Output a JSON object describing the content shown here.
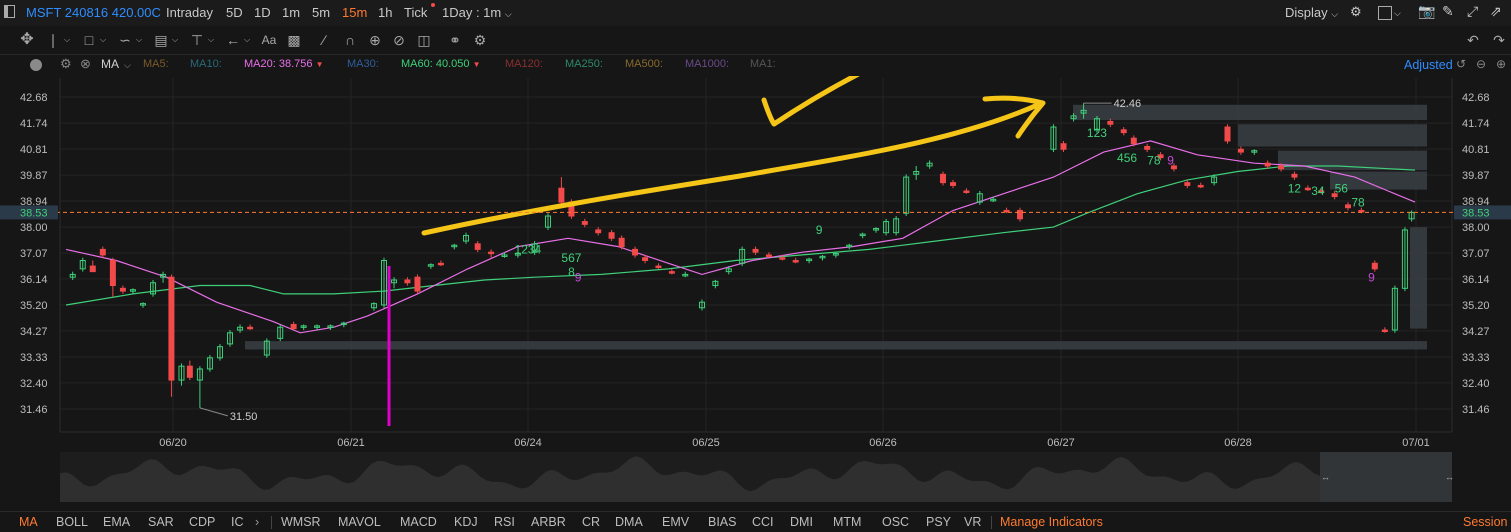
{
  "topbar": {
    "symbol": "MSFT 240816 420.00C",
    "tabs": [
      {
        "label": "Intraday",
        "active": false
      },
      {
        "label": "5D",
        "active": false
      },
      {
        "label": "1D",
        "active": false
      },
      {
        "label": "1m",
        "active": false
      },
      {
        "label": "5m",
        "active": false
      },
      {
        "label": "15m",
        "active": true
      },
      {
        "label": "1h",
        "active": false
      },
      {
        "label": "Tick",
        "active": false
      }
    ],
    "interval_select": "1Day : 1m",
    "display_label": "Display"
  },
  "indicator_bar": {
    "main": "MA",
    "items": [
      {
        "label": "MA5:",
        "value": "",
        "color": "#7a5a2a"
      },
      {
        "label": "MA10:",
        "value": "",
        "color": "#2a5a6a"
      },
      {
        "label": "MA20:",
        "value": "38.756",
        "color": "#e86fe8"
      },
      {
        "label": "MA30:",
        "value": "",
        "color": "#2d4f7a"
      },
      {
        "label": "MA60:",
        "value": "40.050",
        "color": "#3fd07a"
      },
      {
        "label": "MA120:",
        "value": "",
        "color": "#7a2d2d"
      },
      {
        "label": "MA250:",
        "value": "",
        "color": "#2d7a5a"
      },
      {
        "label": "MA500:",
        "value": "",
        "color": "#7a5a2d"
      },
      {
        "label": "MA1000:",
        "value": "",
        "color": "#5a3d7a"
      },
      {
        "label": "MA1:",
        "value": "",
        "color": "#555555"
      }
    ],
    "adjusted_label": "Adjusted"
  },
  "colors": {
    "up": "#3fd07a",
    "down": "#f24a4a",
    "ma20": "#e86fe8",
    "ma60": "#3fd07a",
    "last_price_bg": "#2b3a48",
    "annotation": "#f5c518"
  },
  "chart_data": {
    "type": "candlestick",
    "y_ticks": [
      "42.68",
      "41.74",
      "40.81",
      "39.87",
      "38.94",
      "38.00",
      "37.07",
      "36.14",
      "35.20",
      "34.27",
      "33.33",
      "32.40",
      "31.46"
    ],
    "x_ticks": [
      "06/20",
      "06/21",
      "06/24",
      "06/25",
      "06/26",
      "06/27",
      "06/28",
      "07/01"
    ],
    "last_price": "38.53",
    "high_label": "42.46",
    "low_label": "31.50",
    "ylim": [
      30.8,
      43.1
    ],
    "candles": [
      {
        "t": 0.2,
        "o": 36.2,
        "h": 36.4,
        "l": 36.1,
        "c": 36.3
      },
      {
        "t": 0.5,
        "o": 36.5,
        "h": 36.9,
        "l": 36.4,
        "c": 36.8
      },
      {
        "t": 0.8,
        "o": 36.6,
        "h": 36.8,
        "l": 36.5,
        "c": 36.4
      },
      {
        "t": 1.1,
        "o": 37.2,
        "h": 37.3,
        "l": 36.9,
        "c": 37.0
      },
      {
        "t": 1.4,
        "o": 36.8,
        "h": 36.9,
        "l": 35.5,
        "c": 35.9
      },
      {
        "t": 1.7,
        "o": 35.8,
        "h": 35.9,
        "l": 35.6,
        "c": 35.7
      },
      {
        "t": 2.0,
        "o": 35.7,
        "h": 35.8,
        "l": 35.6,
        "c": 35.75
      },
      {
        "t": 2.3,
        "o": 35.2,
        "h": 35.3,
        "l": 35.1,
        "c": 35.25
      },
      {
        "t": 2.6,
        "o": 35.6,
        "h": 36.1,
        "l": 35.5,
        "c": 36.0
      },
      {
        "t": 2.9,
        "o": 36.2,
        "h": 36.4,
        "l": 36.0,
        "c": 36.3
      },
      {
        "t": 3.15,
        "o": 36.2,
        "h": 36.3,
        "l": 31.9,
        "c": 32.5
      },
      {
        "t": 3.45,
        "o": 32.5,
        "h": 33.1,
        "l": 32.3,
        "c": 33.0
      },
      {
        "t": 3.7,
        "o": 33.0,
        "h": 33.2,
        "l": 32.5,
        "c": 32.6
      },
      {
        "t": 4.0,
        "o": 32.5,
        "h": 33.0,
        "l": 31.5,
        "c": 32.9
      },
      {
        "t": 4.3,
        "o": 32.9,
        "h": 33.4,
        "l": 32.8,
        "c": 33.3
      },
      {
        "t": 4.6,
        "o": 33.3,
        "h": 33.8,
        "l": 33.2,
        "c": 33.7
      },
      {
        "t": 4.9,
        "o": 33.8,
        "h": 34.3,
        "l": 33.7,
        "c": 34.2
      },
      {
        "t": 5.2,
        "o": 34.3,
        "h": 34.5,
        "l": 34.2,
        "c": 34.4
      },
      {
        "t": 5.5,
        "o": 34.4,
        "h": 34.5,
        "l": 34.3,
        "c": 34.35
      },
      {
        "t": 6.0,
        "o": 33.4,
        "h": 34.0,
        "l": 33.3,
        "c": 33.9
      },
      {
        "t": 6.4,
        "o": 34.0,
        "h": 34.5,
        "l": 33.9,
        "c": 34.4
      },
      {
        "t": 6.8,
        "o": 34.5,
        "h": 34.6,
        "l": 34.3,
        "c": 34.35
      },
      {
        "t": 7.1,
        "o": 34.4,
        "h": 34.5,
        "l": 34.3,
        "c": 34.45
      },
      {
        "t": 7.5,
        "o": 34.4,
        "h": 34.5,
        "l": 34.3,
        "c": 34.45
      },
      {
        "t": 7.9,
        "o": 34.4,
        "h": 34.5,
        "l": 34.3,
        "c": 34.45
      },
      {
        "t": 8.3,
        "o": 34.5,
        "h": 34.6,
        "l": 34.4,
        "c": 34.55
      },
      {
        "t": 9.2,
        "o": 35.1,
        "h": 35.3,
        "l": 35.0,
        "c": 35.25
      },
      {
        "t": 9.5,
        "o": 35.2,
        "h": 36.9,
        "l": 35.1,
        "c": 36.8
      },
      {
        "t": 9.8,
        "o": 36.0,
        "h": 36.2,
        "l": 35.8,
        "c": 36.1
      },
      {
        "t": 10.2,
        "o": 36.1,
        "h": 36.2,
        "l": 35.9,
        "c": 36.0
      },
      {
        "t": 10.5,
        "o": 36.2,
        "h": 36.3,
        "l": 35.6,
        "c": 35.7
      },
      {
        "t": 10.9,
        "o": 36.6,
        "h": 36.7,
        "l": 36.5,
        "c": 36.65
      },
      {
        "t": 11.2,
        "o": 36.7,
        "h": 36.8,
        "l": 36.6,
        "c": 36.65
      },
      {
        "t": 11.6,
        "o": 37.3,
        "h": 37.4,
        "l": 37.2,
        "c": 37.35
      },
      {
        "t": 11.95,
        "o": 37.5,
        "h": 37.8,
        "l": 37.4,
        "c": 37.7
      },
      {
        "t": 12.3,
        "o": 37.4,
        "h": 37.5,
        "l": 37.1,
        "c": 37.2
      },
      {
        "t": 12.7,
        "o": 37.1,
        "h": 37.2,
        "l": 36.9,
        "c": 37.05
      },
      {
        "t": 13.1,
        "o": 37.0,
        "h": 37.1,
        "l": 36.9,
        "c": 37.0
      },
      {
        "t": 13.5,
        "o": 37.0,
        "h": 37.1,
        "l": 36.9,
        "c": 37.05
      },
      {
        "t": 14.0,
        "o": 37.1,
        "h": 37.5,
        "l": 37.0,
        "c": 37.4
      },
      {
        "t": 14.4,
        "o": 38.0,
        "h": 38.5,
        "l": 37.9,
        "c": 38.4
      },
      {
        "t": 14.8,
        "o": 39.4,
        "h": 39.8,
        "l": 38.8,
        "c": 38.9
      },
      {
        "t": 15.1,
        "o": 38.9,
        "h": 39.0,
        "l": 38.3,
        "c": 38.4
      },
      {
        "t": 15.5,
        "o": 38.2,
        "h": 38.3,
        "l": 38.0,
        "c": 38.1
      },
      {
        "t": 15.9,
        "o": 37.9,
        "h": 38.0,
        "l": 37.7,
        "c": 37.8
      },
      {
        "t": 16.3,
        "o": 37.8,
        "h": 37.9,
        "l": 37.5,
        "c": 37.6
      },
      {
        "t": 16.6,
        "o": 37.6,
        "h": 37.7,
        "l": 37.2,
        "c": 37.3
      },
      {
        "t": 17.0,
        "o": 37.2,
        "h": 37.3,
        "l": 36.9,
        "c": 37.0
      },
      {
        "t": 17.3,
        "o": 36.9,
        "h": 37.0,
        "l": 36.7,
        "c": 36.8
      },
      {
        "t": 17.7,
        "o": 36.6,
        "h": 36.7,
        "l": 36.5,
        "c": 36.55
      },
      {
        "t": 18.1,
        "o": 36.4,
        "h": 36.5,
        "l": 36.3,
        "c": 36.35
      },
      {
        "t": 18.5,
        "o": 36.3,
        "h": 36.4,
        "l": 36.2,
        "c": 36.3
      },
      {
        "t": 19.0,
        "o": 35.1,
        "h": 35.4,
        "l": 35.0,
        "c": 35.3
      },
      {
        "t": 19.4,
        "o": 35.9,
        "h": 36.1,
        "l": 35.8,
        "c": 36.05
      },
      {
        "t": 19.8,
        "o": 36.4,
        "h": 36.6,
        "l": 36.3,
        "c": 36.5
      },
      {
        "t": 20.2,
        "o": 36.7,
        "h": 37.3,
        "l": 36.6,
        "c": 37.2
      },
      {
        "t": 20.6,
        "o": 37.2,
        "h": 37.3,
        "l": 37.0,
        "c": 37.1
      },
      {
        "t": 21.0,
        "o": 37.0,
        "h": 37.1,
        "l": 36.9,
        "c": 36.95
      },
      {
        "t": 21.4,
        "o": 36.9,
        "h": 37.0,
        "l": 36.8,
        "c": 36.85
      },
      {
        "t": 21.8,
        "o": 36.8,
        "h": 36.9,
        "l": 36.7,
        "c": 36.75
      },
      {
        "t": 22.2,
        "o": 36.8,
        "h": 36.9,
        "l": 36.7,
        "c": 36.85
      },
      {
        "t": 22.6,
        "o": 36.9,
        "h": 37.0,
        "l": 36.8,
        "c": 36.95
      },
      {
        "t": 23.0,
        "o": 37.0,
        "h": 37.1,
        "l": 36.9,
        "c": 37.05
      },
      {
        "t": 23.4,
        "o": 37.3,
        "h": 37.4,
        "l": 37.2,
        "c": 37.35
      },
      {
        "t": 23.8,
        "o": 37.7,
        "h": 37.8,
        "l": 37.6,
        "c": 37.75
      },
      {
        "t": 24.2,
        "o": 37.9,
        "h": 38.0,
        "l": 37.8,
        "c": 37.95
      },
      {
        "t": 24.5,
        "o": 37.8,
        "h": 38.3,
        "l": 37.7,
        "c": 38.2
      },
      {
        "t": 24.8,
        "o": 37.8,
        "h": 38.4,
        "l": 37.7,
        "c": 38.3
      },
      {
        "t": 25.1,
        "o": 38.5,
        "h": 39.9,
        "l": 38.4,
        "c": 39.8
      },
      {
        "t": 25.4,
        "o": 39.9,
        "h": 40.2,
        "l": 39.7,
        "c": 40.0
      },
      {
        "t": 25.8,
        "o": 40.2,
        "h": 40.4,
        "l": 40.1,
        "c": 40.3
      },
      {
        "t": 26.2,
        "o": 39.9,
        "h": 40.0,
        "l": 39.5,
        "c": 39.6
      },
      {
        "t": 26.5,
        "o": 39.6,
        "h": 39.7,
        "l": 39.4,
        "c": 39.5
      },
      {
        "t": 26.9,
        "o": 39.3,
        "h": 39.4,
        "l": 39.2,
        "c": 39.25
      },
      {
        "t": 27.3,
        "o": 38.9,
        "h": 39.3,
        "l": 38.8,
        "c": 39.2
      },
      {
        "t": 27.7,
        "o": 39.0,
        "h": 39.1,
        "l": 38.9,
        "c": 39.0
      },
      {
        "t": 28.1,
        "o": 38.6,
        "h": 38.7,
        "l": 38.5,
        "c": 38.55
      },
      {
        "t": 28.5,
        "o": 38.6,
        "h": 38.7,
        "l": 38.2,
        "c": 38.3
      },
      {
        "t": 29.5,
        "o": 40.8,
        "h": 41.7,
        "l": 40.7,
        "c": 41.6
      },
      {
        "t": 29.8,
        "o": 41.0,
        "h": 41.1,
        "l": 40.7,
        "c": 40.8
      },
      {
        "t": 30.1,
        "o": 41.9,
        "h": 42.1,
        "l": 41.8,
        "c": 42.0
      },
      {
        "t": 30.4,
        "o": 42.1,
        "h": 42.46,
        "l": 41.9,
        "c": 42.2
      },
      {
        "t": 30.8,
        "o": 41.5,
        "h": 42.0,
        "l": 41.4,
        "c": 41.9
      },
      {
        "t": 31.2,
        "o": 41.8,
        "h": 41.9,
        "l": 41.6,
        "c": 41.7
      },
      {
        "t": 31.6,
        "o": 41.5,
        "h": 41.6,
        "l": 41.3,
        "c": 41.4
      },
      {
        "t": 31.9,
        "o": 41.2,
        "h": 41.3,
        "l": 40.9,
        "c": 41.0
      },
      {
        "t": 32.3,
        "o": 40.9,
        "h": 41.0,
        "l": 40.7,
        "c": 40.8
      },
      {
        "t": 32.7,
        "o": 40.6,
        "h": 40.7,
        "l": 40.4,
        "c": 40.5
      },
      {
        "t": 33.1,
        "o": 40.2,
        "h": 40.3,
        "l": 40.0,
        "c": 40.1
      },
      {
        "t": 33.5,
        "o": 39.6,
        "h": 39.7,
        "l": 39.4,
        "c": 39.5
      },
      {
        "t": 33.9,
        "o": 39.5,
        "h": 39.6,
        "l": 39.4,
        "c": 39.45
      },
      {
        "t": 34.3,
        "o": 39.6,
        "h": 39.9,
        "l": 39.5,
        "c": 39.8
      },
      {
        "t": 34.7,
        "o": 41.6,
        "h": 41.7,
        "l": 41.0,
        "c": 41.1
      },
      {
        "t": 35.1,
        "o": 40.8,
        "h": 40.9,
        "l": 40.6,
        "c": 40.7
      },
      {
        "t": 35.5,
        "o": 40.7,
        "h": 40.8,
        "l": 40.6,
        "c": 40.75
      },
      {
        "t": 35.9,
        "o": 40.3,
        "h": 40.4,
        "l": 40.1,
        "c": 40.2
      },
      {
        "t": 36.3,
        "o": 40.2,
        "h": 40.3,
        "l": 40.0,
        "c": 40.1
      },
      {
        "t": 36.7,
        "o": 39.9,
        "h": 40.0,
        "l": 39.7,
        "c": 39.8
      },
      {
        "t": 37.1,
        "o": 39.4,
        "h": 39.5,
        "l": 39.3,
        "c": 39.35
      },
      {
        "t": 37.5,
        "o": 39.3,
        "h": 39.4,
        "l": 39.2,
        "c": 39.25
      },
      {
        "t": 37.9,
        "o": 39.2,
        "h": 39.3,
        "l": 39.0,
        "c": 39.1
      },
      {
        "t": 38.3,
        "o": 38.8,
        "h": 38.9,
        "l": 38.6,
        "c": 38.7
      },
      {
        "t": 38.7,
        "o": 38.6,
        "h": 38.7,
        "l": 38.5,
        "c": 38.55
      },
      {
        "t": 39.1,
        "o": 36.7,
        "h": 36.8,
        "l": 36.4,
        "c": 36.5
      },
      {
        "t": 39.4,
        "o": 34.3,
        "h": 34.4,
        "l": 34.2,
        "c": 34.25
      },
      {
        "t": 39.7,
        "o": 34.3,
        "h": 35.9,
        "l": 34.2,
        "c": 35.8
      },
      {
        "t": 40.0,
        "o": 35.8,
        "h": 38.0,
        "l": 35.7,
        "c": 37.9
      },
      {
        "t": 40.2,
        "o": 38.3,
        "h": 38.6,
        "l": 38.2,
        "c": 38.53
      }
    ],
    "ma20": [
      [
        0,
        37.2
      ],
      [
        1.5,
        36.8
      ],
      [
        3,
        36.2
      ],
      [
        4.5,
        35.3
      ],
      [
        6.2,
        34.6
      ],
      [
        7,
        34.2
      ],
      [
        8,
        34.4
      ],
      [
        9,
        34.8
      ],
      [
        10.5,
        35.6
      ],
      [
        12,
        36.5
      ],
      [
        13.5,
        37.3
      ],
      [
        15,
        37.6
      ],
      [
        16.5,
        37.3
      ],
      [
        18,
        36.7
      ],
      [
        19,
        36.3
      ],
      [
        20.5,
        36.8
      ],
      [
        22,
        37.1
      ],
      [
        23.5,
        37.3
      ],
      [
        25,
        37.6
      ],
      [
        26.5,
        38.6
      ],
      [
        28,
        39.2
      ],
      [
        29.5,
        39.8
      ],
      [
        31,
        40.7
      ],
      [
        32.4,
        41.1
      ],
      [
        33.8,
        40.6
      ],
      [
        35.5,
        40.3
      ],
      [
        37,
        40.2
      ],
      [
        38.5,
        39.8
      ],
      [
        39.5,
        39.3
      ],
      [
        40.3,
        38.9
      ]
    ],
    "ma60": [
      [
        0,
        35.2
      ],
      [
        2,
        35.6
      ],
      [
        4,
        35.9
      ],
      [
        5.5,
        35.9
      ],
      [
        6.5,
        35.6
      ],
      [
        8,
        35.6
      ],
      [
        9.5,
        35.7
      ],
      [
        11,
        35.9
      ],
      [
        12.5,
        36.1
      ],
      [
        14,
        36.2
      ],
      [
        16,
        36.3
      ],
      [
        18,
        36.5
      ],
      [
        20,
        36.8
      ],
      [
        22,
        37.0
      ],
      [
        24,
        37.2
      ],
      [
        26,
        37.5
      ],
      [
        28,
        37.8
      ],
      [
        29.5,
        38.0
      ],
      [
        30.5,
        38.5
      ],
      [
        32,
        39.2
      ],
      [
        33.5,
        39.7
      ],
      [
        35,
        40.0
      ],
      [
        36.5,
        40.2
      ],
      [
        38,
        40.2
      ],
      [
        39.5,
        40.1
      ],
      [
        40.3,
        40.05
      ]
    ],
    "labels": [
      {
        "t": 22.4,
        "v": 37.75,
        "text": "9",
        "color": "#3fd07a"
      },
      {
        "t": 13.4,
        "v": 37.05,
        "text": "1234",
        "color": "#3fd07a"
      },
      {
        "t": 14.8,
        "v": 36.75,
        "text": "567",
        "color": "#3fd07a"
      },
      {
        "t": 15.0,
        "v": 36.25,
        "text": "8",
        "color": "#3fd07a"
      },
      {
        "t": 15.2,
        "v": 36.05,
        "text": "9",
        "color": "#c84adc"
      },
      {
        "t": 30.5,
        "v": 41.25,
        "text": "123",
        "color": "#3fd07a"
      },
      {
        "t": 31.4,
        "v": 40.35,
        "text": "456",
        "color": "#3fd07a"
      },
      {
        "t": 32.3,
        "v": 40.25,
        "text": "78",
        "color": "#3fd07a"
      },
      {
        "t": 32.9,
        "v": 40.25,
        "text": "9",
        "color": "#c84adc"
      },
      {
        "t": 36.5,
        "v": 39.25,
        "text": "12",
        "color": "#3fd07a"
      },
      {
        "t": 37.2,
        "v": 39.15,
        "text": "34",
        "color": "#3fd07a"
      },
      {
        "t": 37.9,
        "v": 39.25,
        "text": "56",
        "color": "#3fd07a"
      },
      {
        "t": 38.4,
        "v": 38.75,
        "text": "78",
        "color": "#3fd07a"
      },
      {
        "t": 38.9,
        "v": 36.05,
        "text": "9",
        "color": "#c84adc"
      }
    ]
  },
  "bottom_tabs": [
    {
      "label": "MA",
      "active": true
    },
    {
      "label": "BOLL",
      "active": false
    },
    {
      "label": "EMA",
      "active": false
    },
    {
      "label": "SAR",
      "active": false
    },
    {
      "label": "CDP",
      "active": false
    },
    {
      "label": "IC",
      "active": false
    },
    {
      "label": "WMSR",
      "active": false
    },
    {
      "label": "MAVOL",
      "active": false
    },
    {
      "label": "MACD",
      "active": false
    },
    {
      "label": "KDJ",
      "active": false
    },
    {
      "label": "RSI",
      "active": false
    },
    {
      "label": "ARBR",
      "active": false
    },
    {
      "label": "CR",
      "active": false
    },
    {
      "label": "DMA",
      "active": false
    },
    {
      "label": "EMV",
      "active": false
    },
    {
      "label": "BIAS",
      "active": false
    },
    {
      "label": "CCI",
      "active": false
    },
    {
      "label": "DMI",
      "active": false
    },
    {
      "label": "MTM",
      "active": false
    },
    {
      "label": "OSC",
      "active": false
    },
    {
      "label": "PSY",
      "active": false
    },
    {
      "label": "VR",
      "active": false
    }
  ],
  "manage_label": "Manage Indicators",
  "session_label": "Session"
}
